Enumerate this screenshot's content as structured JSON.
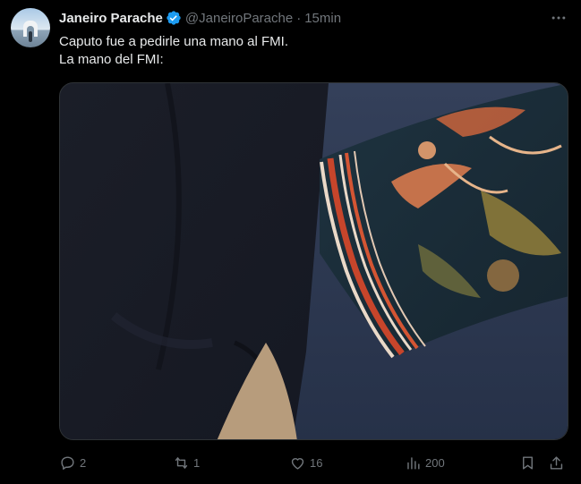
{
  "tweet": {
    "author_name": "Janeiro Parache",
    "handle": "@JaneiroParache",
    "separator": "·",
    "time": "15min",
    "text_line1": "Caputo fue a pedirle una mano al FMI.",
    "text_line2": "La mano del FMI:"
  },
  "actions": {
    "replies": "2",
    "reposts": "1",
    "likes": "16",
    "views": "200"
  },
  "icons": {
    "verified": "verified-badge-icon",
    "more": "more-options-icon",
    "reply": "reply-icon",
    "repost": "repost-icon",
    "like": "heart-icon",
    "views": "views-chart-icon",
    "bookmark": "bookmark-icon",
    "share": "share-icon"
  },
  "colors": {
    "background": "#000000",
    "text_primary": "#e7e9ea",
    "text_secondary": "#71767b",
    "verified_blue": "#1d9bf0"
  }
}
